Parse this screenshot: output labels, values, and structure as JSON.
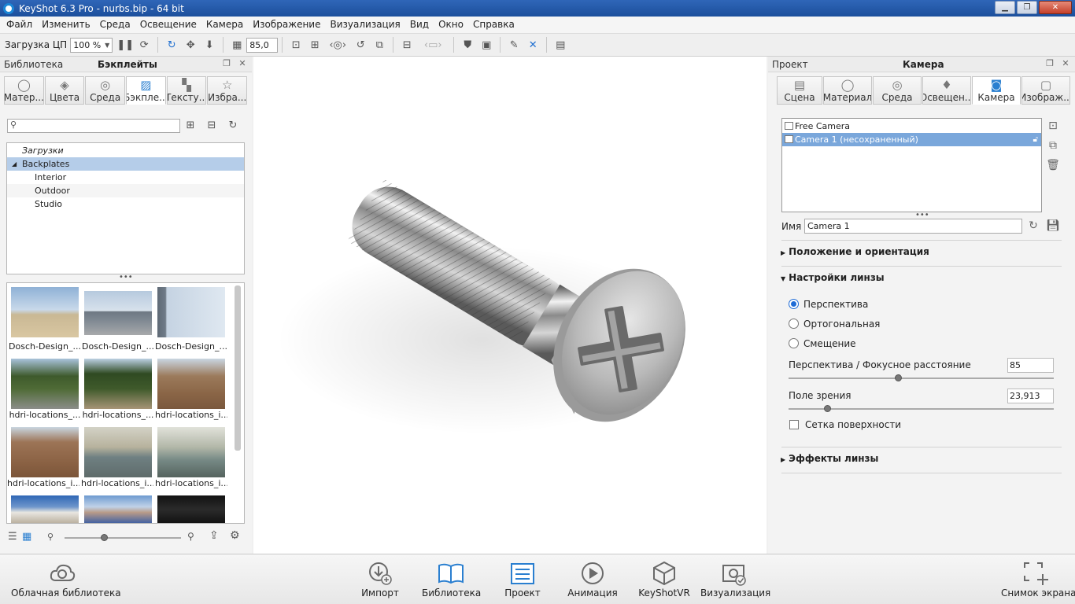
{
  "window": {
    "title": "KeyShot 6.3 Pro - nurbs.bip  - 64 bit"
  },
  "menu": [
    "Файл",
    "Изменить",
    "Среда",
    "Освещение",
    "Камера",
    "Изображение",
    "Визуализация",
    "Вид",
    "Окно",
    "Справка"
  ],
  "toolbar": {
    "cpu_label": "Загрузка ЦП",
    "cpu_value": "100 %",
    "fov_value": "85,0"
  },
  "library": {
    "header_left": "Библиотека",
    "header_title": "Бэкплейты",
    "tabs": [
      "Матер...",
      "Цвета",
      "Среда",
      "Бэкпле...",
      "Тексту...",
      "Избра..."
    ],
    "active_tab_index": 3,
    "search_placeholder": "",
    "tree": {
      "downloads": "Загрузки",
      "root": "Backplates",
      "children": [
        "Interior",
        "Outdoor",
        "Studio"
      ]
    },
    "thumbnails": [
      "Dosch-Design_...",
      "Dosch-Design_...",
      "Dosch-Design_...",
      "hdri-locations_...",
      "hdri-locations_...",
      "hdri-locations_i...",
      "hdri-locations_i...",
      "hdri-locations_i...",
      "hdri-locations_i..."
    ]
  },
  "project": {
    "header_left": "Проект",
    "header_title": "Камера",
    "tabs": [
      "Сцена",
      "Материал",
      "Среда",
      "Освещен...",
      "Камера",
      "Изображ..."
    ],
    "active_tab_index": 4,
    "cameras": [
      "Free Camera",
      "Camera 1 (несохраненный)"
    ],
    "selected_camera_index": 1,
    "name_label": "Имя",
    "name_value": "Camera 1",
    "sections": {
      "position": "Положение и ориентация",
      "lens": "Настройки линзы",
      "effects": "Эффекты линзы"
    },
    "projection_options": [
      "Перспектива",
      "Ортогональная",
      "Смещение"
    ],
    "projection_selected": 0,
    "focal_label": "Перспектива / Фокусное расстояние",
    "focal_value": "85",
    "fov_label": "Поле зрения",
    "fov_value": "23,913",
    "grid_label": "Сетка поверхности",
    "grid_checked": false
  },
  "bottombar": {
    "cloud": "Облачная библиотека",
    "import": "Импорт",
    "library": "Библиотека",
    "project": "Проект",
    "animation": "Анимация",
    "keyshotvr": "KeyShotVR",
    "render": "Визуализация",
    "screenshot": "Снимок экрана"
  }
}
